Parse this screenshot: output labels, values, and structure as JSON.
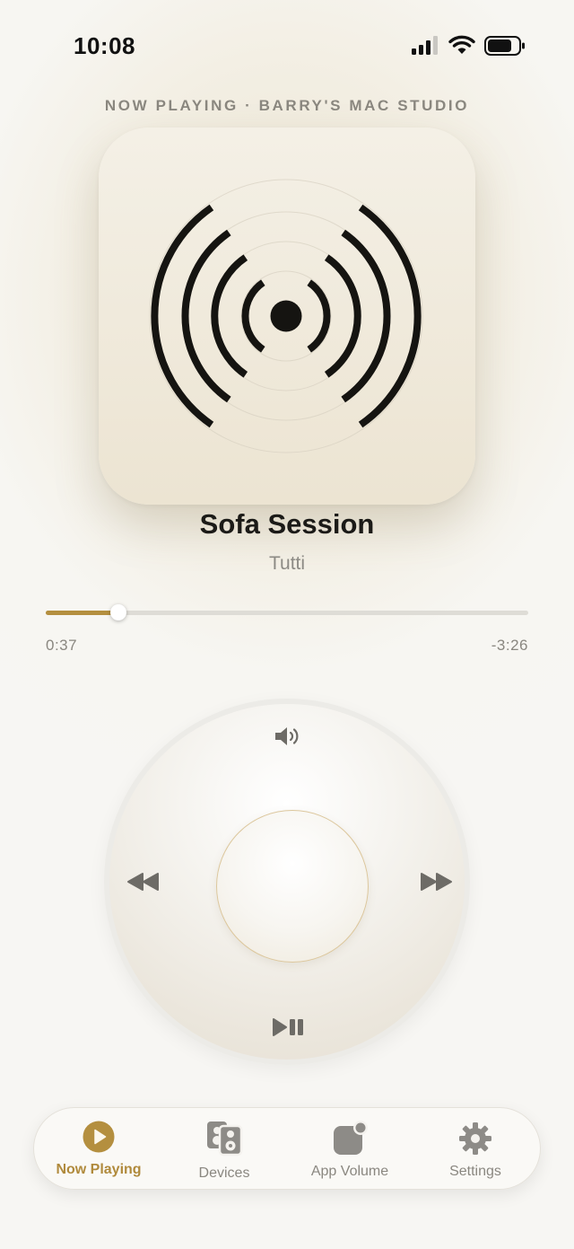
{
  "status_bar": {
    "time": "10:08"
  },
  "now_playing": {
    "source": "NOW PLAYING · BARRY'S MAC STUDIO",
    "title": "Sofa Session",
    "artist": "Tutti",
    "elapsed": "0:37",
    "remaining": "-3:26",
    "progress_fraction": 0.15
  },
  "controls": {
    "volume": "speaker-icon",
    "previous": "rewind-icon",
    "next": "fast-forward-icon",
    "play_pause": "play-pause-icon"
  },
  "tabs": [
    {
      "label": "Now Playing",
      "icon": "play-circle-icon",
      "active": true
    },
    {
      "label": "Devices",
      "icon": "speakers-icon",
      "active": false
    },
    {
      "label": "App Volume",
      "icon": "app-badge-icon",
      "active": false
    },
    {
      "label": "Settings",
      "icon": "gear-icon",
      "active": false
    }
  ],
  "colors": {
    "accent": "#b48f3f",
    "inactive": "#8a8780",
    "text": "#1b1a17"
  }
}
